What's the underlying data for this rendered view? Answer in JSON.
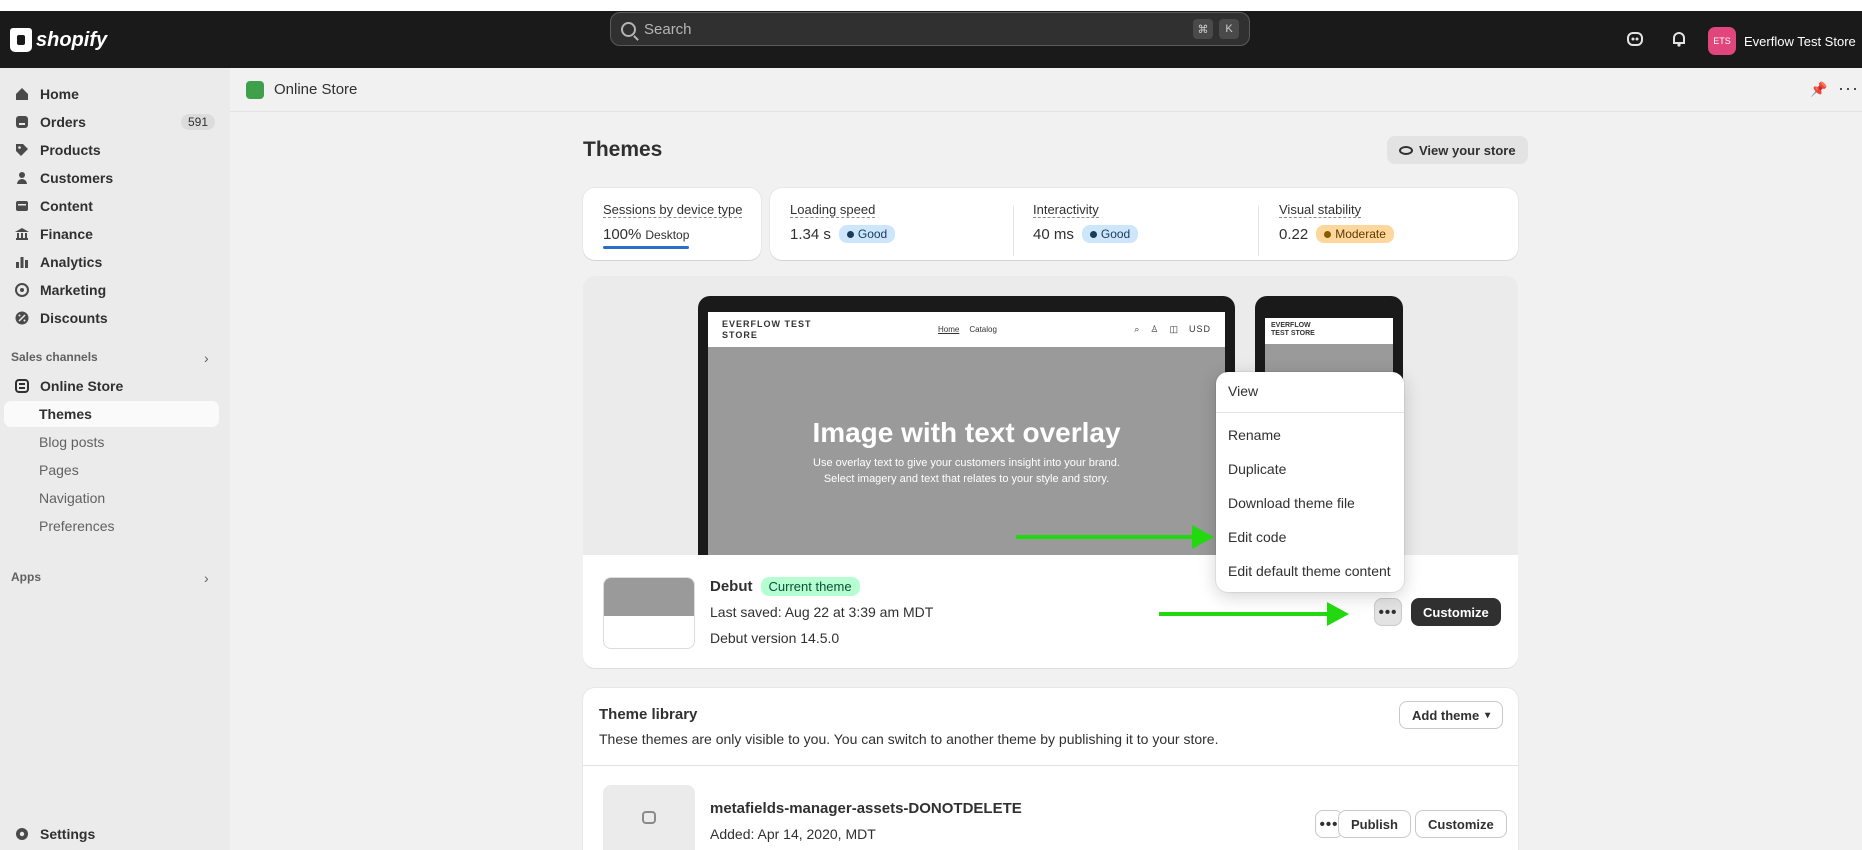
{
  "topbar": {
    "brand": "shopify",
    "search_placeholder": "Search",
    "shortcut_keys": [
      "⌘",
      "K"
    ],
    "store_initials": "ETS",
    "store_name": "Everflow Test Store"
  },
  "sidebar": {
    "items": [
      {
        "label": "Home",
        "icon": "home-icon"
      },
      {
        "label": "Orders",
        "icon": "orders-icon",
        "badge": "591"
      },
      {
        "label": "Products",
        "icon": "tag-icon"
      },
      {
        "label": "Customers",
        "icon": "person-icon"
      },
      {
        "label": "Content",
        "icon": "content-icon"
      },
      {
        "label": "Finance",
        "icon": "bank-icon"
      },
      {
        "label": "Analytics",
        "icon": "bar-chart-icon"
      },
      {
        "label": "Marketing",
        "icon": "target-icon"
      },
      {
        "label": "Discounts",
        "icon": "discount-icon"
      }
    ],
    "sales_channels_label": "Sales channels",
    "online_store_label": "Online Store",
    "sub_items": [
      "Themes",
      "Blog posts",
      "Pages",
      "Navigation",
      "Preferences"
    ],
    "apps_label": "Apps",
    "settings_label": "Settings"
  },
  "page": {
    "breadcrumb": "Online Store",
    "title": "Themes",
    "view_store_label": "View your store"
  },
  "metrics": {
    "sessions_label": "Sessions by device type",
    "sessions_value": "100%",
    "sessions_device": "Desktop",
    "loading_label": "Loading speed",
    "loading_value": "1.34 s",
    "loading_status": "Good",
    "interactivity_label": "Interactivity",
    "interactivity_value": "40 ms",
    "interactivity_status": "Good",
    "visual_label": "Visual stability",
    "visual_value": "0.22",
    "visual_status": "Moderate"
  },
  "preview": {
    "store_name": "EVERFLOW TEST STORE",
    "nav_links": [
      "Home",
      "Catalog"
    ],
    "currency": "USD",
    "hero_title": "Image with text overlay",
    "hero_line1": "Use overlay text to give your customers insight into your brand.",
    "hero_line2": "Select imagery and text that relates to your style and story.",
    "mobile_store_name": "EVERFLOW TEST STORE"
  },
  "current_theme": {
    "name": "Debut",
    "badge": "Current theme",
    "last_saved": "Last saved: Aug 22 at 3:39 am MDT",
    "version": "Debut version 14.5.0",
    "customize_label": "Customize",
    "more_label": "•••"
  },
  "menu": {
    "items": [
      "View",
      "Rename",
      "Duplicate",
      "Download theme file",
      "Edit code",
      "Edit default theme content"
    ]
  },
  "library": {
    "title": "Theme library",
    "description": "These themes are only visible to you. You can switch to another theme by publishing it to your store.",
    "add_theme_label": "Add theme",
    "theme_name": "metafields-manager-assets-DONOTDELETE",
    "theme_added": "Added: Apr 14, 2020, MDT",
    "publish_label": "Publish",
    "customize_label": "Customize",
    "more_label": "•••"
  },
  "colors": {
    "arrow": "#22d80f",
    "topbar": "#1a1a1a",
    "current_badge": "#b4fed2",
    "good_badge": "#cde6fb",
    "moderate_badge": "#ffd79d"
  }
}
